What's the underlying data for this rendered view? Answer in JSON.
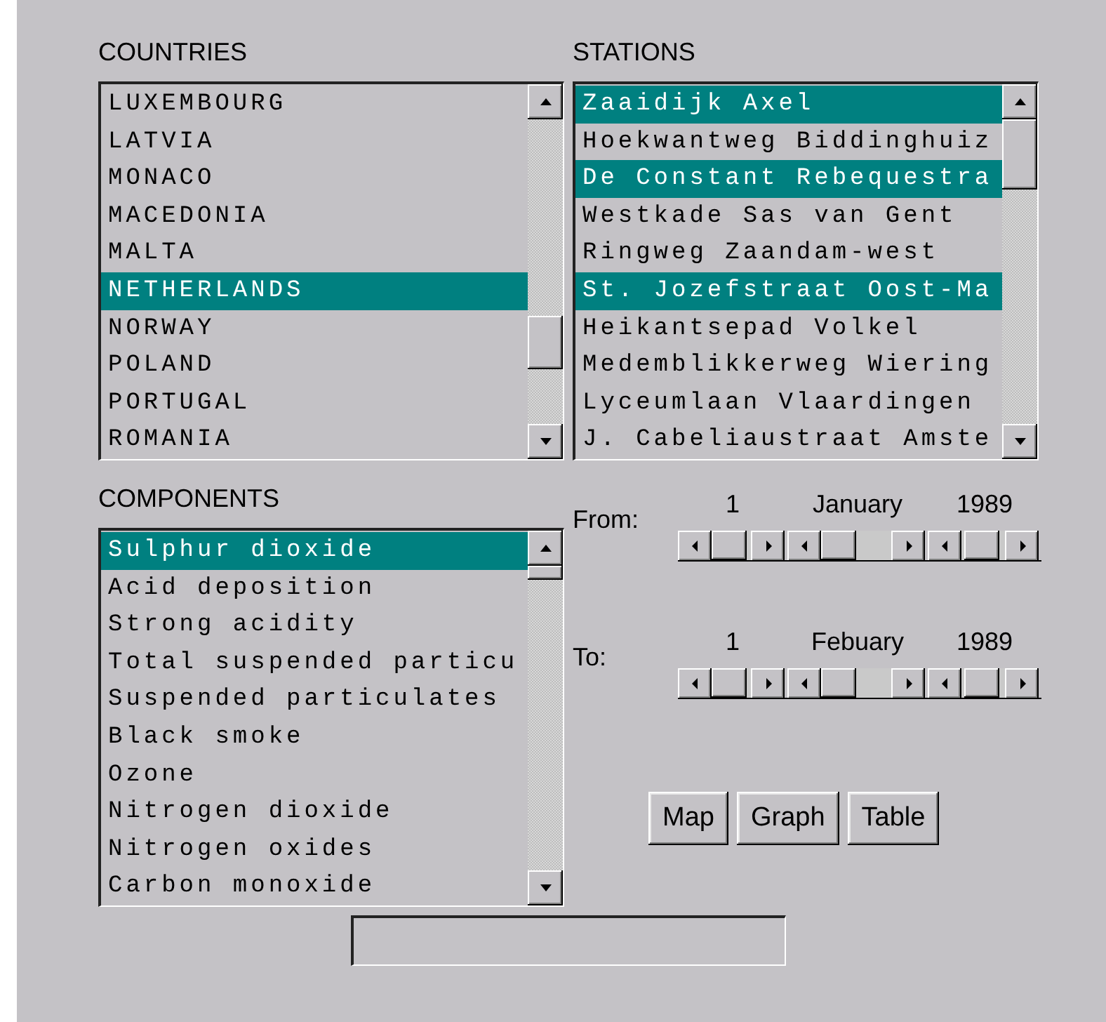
{
  "countries": {
    "label": "COUNTRIES",
    "items": [
      {
        "text": "LUXEMBOURG",
        "selected": false
      },
      {
        "text": "LATVIA",
        "selected": false
      },
      {
        "text": "MONACO",
        "selected": false
      },
      {
        "text": "MACEDONIA",
        "selected": false
      },
      {
        "text": "MALTA",
        "selected": false
      },
      {
        "text": "NETHERLANDS",
        "selected": true
      },
      {
        "text": "NORWAY",
        "selected": false
      },
      {
        "text": "POLAND",
        "selected": false
      },
      {
        "text": "PORTUGAL",
        "selected": false
      },
      {
        "text": "ROMANIA",
        "selected": false
      }
    ]
  },
  "stations": {
    "label": "STATIONS",
    "items": [
      {
        "text": "Zaaidijk Axel",
        "selected": true
      },
      {
        "text": "Hoekwantweg Biddinghuiz",
        "selected": false
      },
      {
        "text": "De Constant Rebequestra",
        "selected": true
      },
      {
        "text": "Westkade Sas van Gent",
        "selected": false
      },
      {
        "text": "Ringweg Zaandam-west",
        "selected": false
      },
      {
        "text": "St. Jozefstraat Oost-Ma",
        "selected": true
      },
      {
        "text": "Heikantsepad Volkel",
        "selected": false
      },
      {
        "text": "Medemblikkerweg Wiering",
        "selected": false
      },
      {
        "text": "Lyceumlaan Vlaardingen",
        "selected": false
      },
      {
        "text": "J. Cabeliaustraat Amste",
        "selected": false
      }
    ]
  },
  "components": {
    "label": "COMPONENTS",
    "items": [
      {
        "text": "Sulphur dioxide",
        "selected": true
      },
      {
        "text": "Acid deposition",
        "selected": false
      },
      {
        "text": "Strong acidity",
        "selected": false
      },
      {
        "text": "Total suspended particu",
        "selected": false
      },
      {
        "text": "Suspended particulates",
        "selected": false
      },
      {
        "text": "Black smoke",
        "selected": false
      },
      {
        "text": "Ozone",
        "selected": false
      },
      {
        "text": "Nitrogen dioxide",
        "selected": false
      },
      {
        "text": "Nitrogen oxides",
        "selected": false
      },
      {
        "text": "Carbon monoxide",
        "selected": false
      }
    ]
  },
  "from": {
    "label": "From:",
    "day": "1",
    "month": "January",
    "year": "1989"
  },
  "to": {
    "label": "To:",
    "day": "1",
    "month": "Febuary",
    "year": "1989"
  },
  "buttons": [
    "Map",
    "Graph",
    "Table"
  ]
}
